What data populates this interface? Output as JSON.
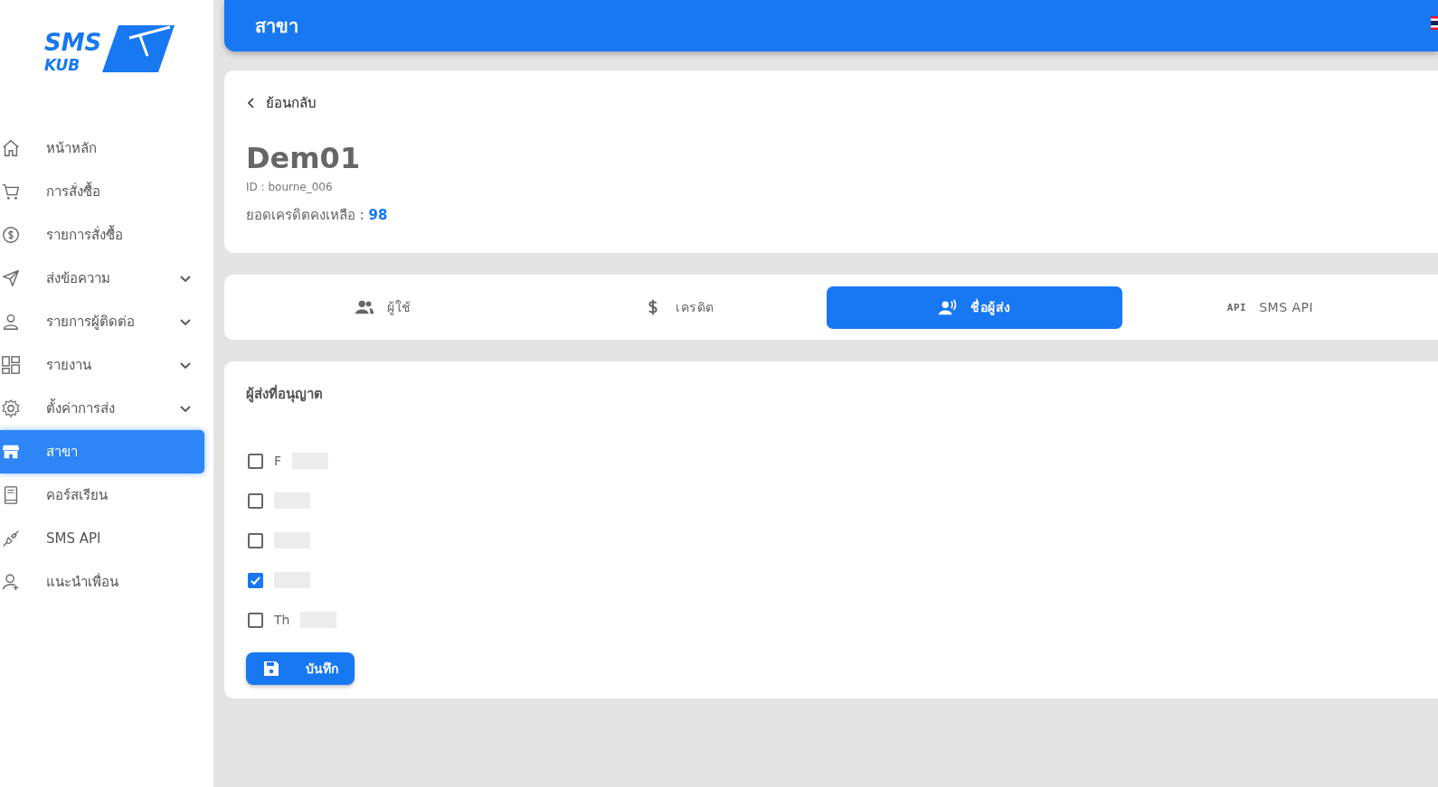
{
  "logo": {
    "line_1": "SMS",
    "line_2": "KUB"
  },
  "sidebar": {
    "items": [
      {
        "label": "หน้าหลัก",
        "expandable": false,
        "selected": false
      },
      {
        "label": "การสั่งซื้อ",
        "expandable": false,
        "selected": false
      },
      {
        "label": "รายการสั่งซื้อ",
        "expandable": false,
        "selected": false
      },
      {
        "label": "ส่งข้อความ",
        "expandable": true,
        "selected": false
      },
      {
        "label": "รายการผู้ติดต่อ",
        "expandable": true,
        "selected": false
      },
      {
        "label": "รายงาน",
        "expandable": true,
        "selected": false
      },
      {
        "label": "ตั้งค่าการส่ง",
        "expandable": true,
        "selected": false
      },
      {
        "label": "สาขา",
        "expandable": false,
        "selected": true
      },
      {
        "label": "คอร์สเรียน",
        "expandable": false,
        "selected": false
      },
      {
        "label": "SMS API",
        "expandable": false,
        "selected": false
      },
      {
        "label": "แนะนำเพื่อน",
        "expandable": false,
        "selected": false
      }
    ]
  },
  "header": {
    "title": "สาขา"
  },
  "branch": {
    "back_link": "ย้อนกลับ",
    "name": "Dem01",
    "id_line": "ID : bourne_006",
    "credit_label": "ยอดเครดิตคงเหลือ : ",
    "credit_value": "98"
  },
  "tabs": [
    {
      "label": "ผู้ใช้",
      "selected": false
    },
    {
      "label": "เครดิต",
      "selected": false
    },
    {
      "label": "ชื่อผู้ส่ง",
      "selected": true
    },
    {
      "icon_text": "API",
      "label": "SMS API",
      "selected": false
    }
  ],
  "senders": {
    "title": "ผู้ส่งที่อนุญาต",
    "options": [
      {
        "label": "F",
        "checked": false
      },
      {
        "checked": false
      },
      {
        "checked": false
      },
      {
        "checked": true
      },
      {
        "label": "Th",
        "checked": false
      }
    ],
    "save_button": "บันทึก"
  }
}
